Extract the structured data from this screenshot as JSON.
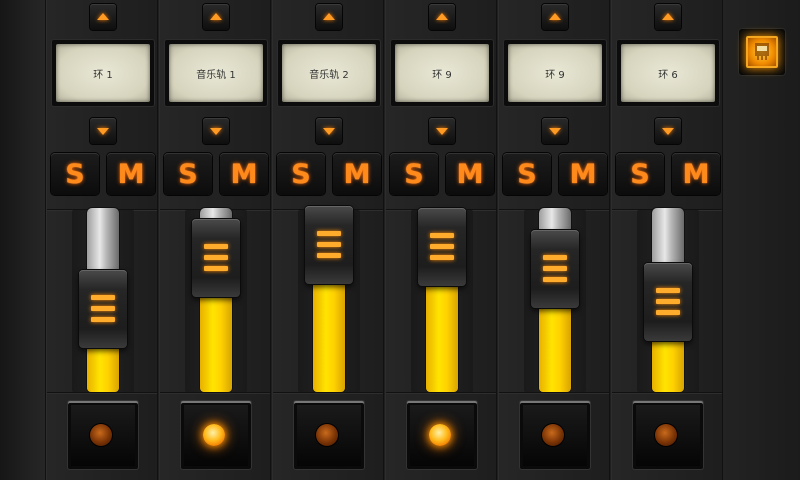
{
  "colors": {
    "accent": "#ff8a1c",
    "level_fill": "#ffe400",
    "led_on": "#ffbb1c",
    "lcd_bg": "#e2e0cb"
  },
  "menu_button": {
    "icon": "orange-menu-icon"
  },
  "channels": [
    {
      "name": "环 1",
      "level": 0.27,
      "led_on": false
    },
    {
      "name": "音乐轨 1",
      "level": 0.55,
      "led_on": true
    },
    {
      "name": "音乐轨 2",
      "level": 0.62,
      "led_on": false
    },
    {
      "name": "环 9",
      "level": 0.61,
      "led_on": true
    },
    {
      "name": "环 9",
      "level": 0.49,
      "led_on": false
    },
    {
      "name": "环 6",
      "level": 0.31,
      "led_on": false
    }
  ],
  "labels": {
    "solo": "S",
    "mute": "M"
  }
}
